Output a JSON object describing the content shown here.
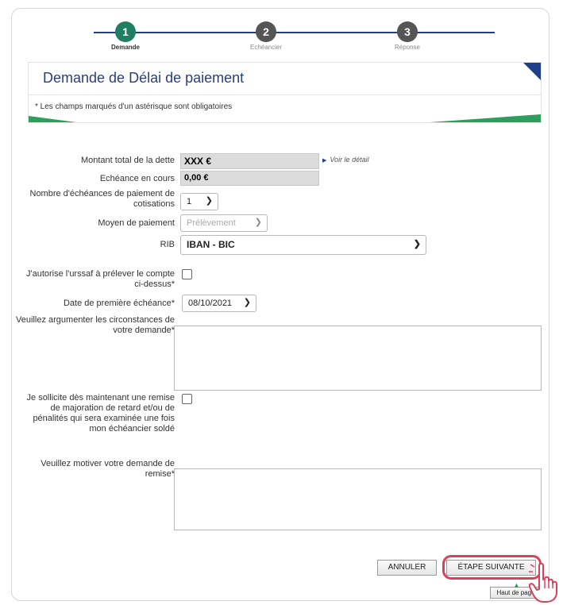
{
  "stepper": {
    "steps": [
      {
        "number": "1",
        "label": "Demande",
        "color": "#1f7f62"
      },
      {
        "number": "2",
        "label": "Echéancier",
        "color": "#555555"
      },
      {
        "number": "3",
        "label": "Réponse",
        "color": "#555555"
      }
    ]
  },
  "header": {
    "title": "Demande de Délai de paiement",
    "note": "* Les champs marqués d'un astérisque sont obligatoires"
  },
  "form": {
    "montant_label": "Montant total de la dette",
    "montant_value": "XXX €",
    "voir_detail": "Voir le détail",
    "echeance_label": "Echéance en cours",
    "echeance_value": "0,00 €",
    "nombre_label": "Nombre d'échéances de paiement de cotisations",
    "nombre_value": "1",
    "moyen_label": "Moyen de paiement",
    "moyen_value": "Prélèvement",
    "rib_label": "RIB",
    "rib_value": "IBAN - BIC",
    "autorise_label": "J'autorise l'urssaf à prélever le compte ci-dessus*",
    "date_label": "Date de première échéance*",
    "date_value": "08/10/2021",
    "argumenter_label": "Veuillez argumenter les circonstances de votre demande*",
    "sollicite_label": "Je sollicite dès maintenant une remise de majoration de retard et/ou de pénalités qui sera examinée une fois mon échéancier soldé",
    "motiver_label": "Veuillez motiver votre demande de remise*"
  },
  "buttons": {
    "annuler": "ANNULER",
    "suivante": "ÉTAPE SUIVANTE",
    "haut": "Haut de page"
  },
  "colors": {
    "brand_blue": "#1f3f8a",
    "brand_green": "#2e9e5c",
    "highlight": "#d9435a"
  }
}
